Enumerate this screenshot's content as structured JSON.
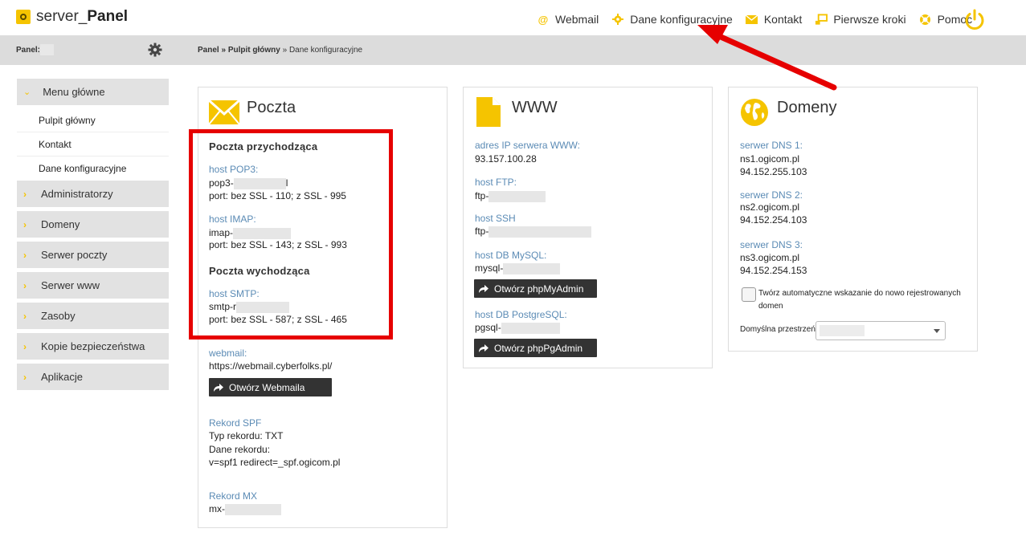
{
  "app": {
    "logo_prefix": "server",
    "logo_sep": "_",
    "logo_bold": "Panel"
  },
  "topnav": [
    {
      "label": "Webmail",
      "icon": "at-icon"
    },
    {
      "label": "Dane konfiguracyjne",
      "icon": "gear-icon"
    },
    {
      "label": "Kontakt",
      "icon": "envelope-icon"
    },
    {
      "label": "Pierwsze kroki",
      "icon": "steps-icon"
    },
    {
      "label": "Pomoc",
      "icon": "lifebuoy-icon"
    }
  ],
  "header": {
    "panel_label": "Panel:",
    "breadcrumb_root": "Panel",
    "breadcrumb_sep": "»",
    "breadcrumb_mid": "Pulpit główny",
    "breadcrumb_current": "Dane konfiguracyjne"
  },
  "sidebar": {
    "main_label": "Menu główne",
    "subitems": [
      "Pulpit główny",
      "Kontakt",
      "Dane konfiguracyjne"
    ],
    "items": [
      "Administratorzy",
      "Domeny",
      "Serwer poczty",
      "Serwer www",
      "Zasoby",
      "Kopie bezpieczeństwa",
      "Aplikacje"
    ]
  },
  "poczta": {
    "title": "Poczta",
    "incoming_heading": "Poczta przychodząca",
    "pop3_label": "host POP3:",
    "pop3_value": "pop3-",
    "pop3_suffix": "l",
    "pop3_ports": "port: bez SSL - 110; z SSL - 995",
    "imap_label": "host IMAP:",
    "imap_value": "imap-",
    "imap_ports": "port: bez SSL - 143; z SSL - 993",
    "outgoing_heading": "Poczta wychodząca",
    "smtp_label": "host SMTP:",
    "smtp_value": "smtp-r",
    "smtp_ports": "port: bez SSL - 587; z SSL - 465",
    "webmail_label": "webmail:",
    "webmail_value": "https://webmail.cyberfolks.pl/",
    "webmail_button": "Otwórz Webmaila",
    "spf_label": "Rekord SPF",
    "spf_type": "Typ rekordu: TXT",
    "spf_data_label": "Dane rekordu:",
    "spf_data": "v=spf1 redirect=_spf.ogicom.pl",
    "mx_label": "Rekord MX",
    "mx_value": "mx-"
  },
  "www": {
    "title": "WWW",
    "ip_label": "adres IP serwera WWW:",
    "ip_value": "93.157.100.28",
    "ftp_label": "host FTP:",
    "ftp_value": "ftp-",
    "ssh_label": "host SSH",
    "ssh_value": "ftp-",
    "mysql_label": "host DB MySQL:",
    "mysql_value": "mysql-",
    "mysql_button": "Otwórz phpMyAdmin",
    "pg_label": "host DB PostgreSQL:",
    "pg_value": "pgsql-",
    "pg_button": "Otwórz phpPgAdmin"
  },
  "domeny": {
    "title": "Domeny",
    "dns1_label": "serwer DNS 1:",
    "dns1_host": "ns1.ogicom.pl",
    "dns1_ip": "94.152.255.103",
    "dns2_label": "serwer DNS 2:",
    "dns2_host": "ns2.ogicom.pl",
    "dns2_ip": "94.152.254.103",
    "dns3_label": "serwer DNS 3:",
    "dns3_host": "ns3.ogicom.pl",
    "dns3_ip": "94.152.254.153",
    "checkbox_label_1": "Twórz automatyczne wskazanie do nowo rejestrowanych",
    "checkbox_label_2": "domen",
    "namespace_label": "Domyślna przestrzeń:"
  },
  "colors": {
    "accent": "#f5c400",
    "link": "#5b8bb5",
    "annotation": "#e60000",
    "sidebar_bg": "#e2e2e2",
    "header_bg": "#dcdcdc"
  }
}
